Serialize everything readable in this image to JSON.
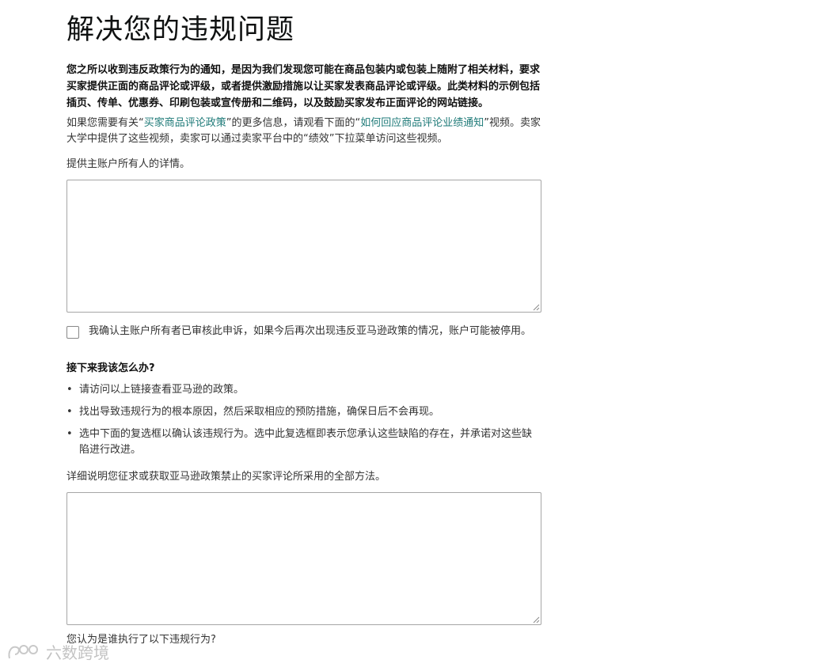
{
  "page": {
    "title": "解决您的违规问题",
    "intro": "您之所以收到违反政策行为的通知，是因为我们发现您可能在商品包装内或包装上随附了相关材料，要求买家提供正面的商品评论或评级，或者提供激励措施以让买家发表商品评论或评级。此类材料的示例包括插页、传单、优惠券、印刷包装或宣传册和二维码，以及鼓励买家发布正面评论的网站链接。",
    "info": {
      "part1": "如果您需要有关“",
      "link1": "买家商品评论政策",
      "part2": "”的更多信息，请观看下面的“",
      "link2": "如何回应商品评论业绩通知",
      "part3": "”视频。卖家大学中提供了这些视频，卖家可以通过卖家平台中的“绩效”下拉菜单访问这些视频。"
    }
  },
  "form": {
    "owner_details_label": "提供主账户所有人的详情。",
    "owner_details_value": "",
    "confirm_label": "我确认主账户所有者已审核此申诉，如果今后再次出现违反亚马逊政策的情况，账户可能被停用。",
    "confirm_checked": false,
    "methods_label": "详细说明您征求或获取亚马逊政策禁止的买家评论所采用的全部方法。",
    "methods_value": "",
    "who_label": "您认为是谁执行了以下违规行为?"
  },
  "next_steps": {
    "title": "接下来我该怎么办?",
    "items": [
      " 请访问以上链接查看亚马逊的政策。",
      "找出导致违规行为的根本原因，然后采取相应的预防措施，确保日后不会再现。",
      "选中下面的复选框以确认该违规行为。选中此复选框即表示您承认这些缺陷的存在，并承诺对这些缺陷进行改进。"
    ]
  },
  "watermark": {
    "text": "六数跨境"
  },
  "colors": {
    "link": "#1e7a78",
    "text": "#333333",
    "border": "#a6a6a6"
  }
}
